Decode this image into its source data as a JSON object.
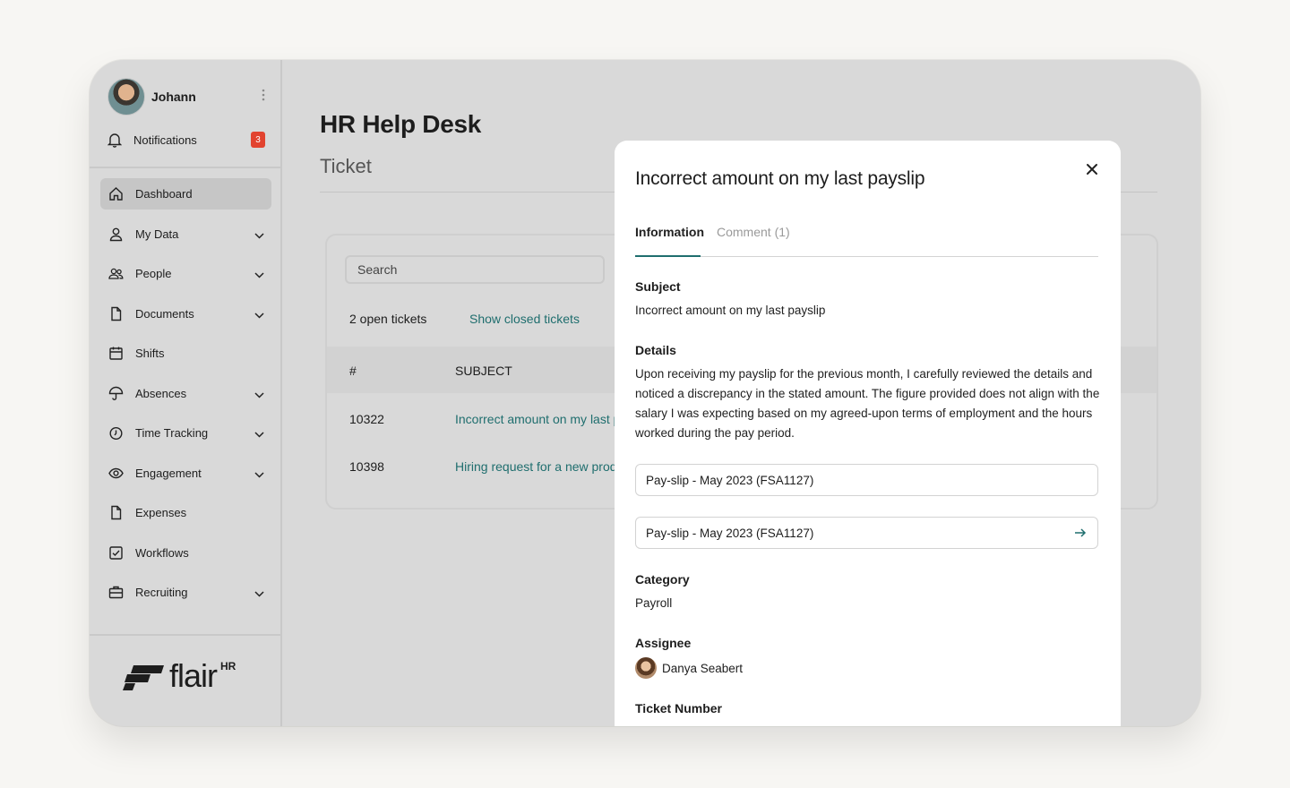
{
  "user": {
    "name": "Johann",
    "more_icon": "kebab-icon"
  },
  "notifications": {
    "label": "Notifications",
    "count": "3"
  },
  "nav": {
    "items": [
      {
        "label": "Dashboard",
        "icon": "home-icon",
        "active": true,
        "expandable": false
      },
      {
        "label": "My Data",
        "icon": "user-icon",
        "expandable": true
      },
      {
        "label": "People",
        "icon": "users-icon",
        "expandable": true
      },
      {
        "label": "Documents",
        "icon": "document-icon",
        "expandable": true
      },
      {
        "label": "Shifts",
        "icon": "calendar-icon",
        "expandable": false
      },
      {
        "label": "Absences",
        "icon": "umbrella-icon",
        "expandable": true
      },
      {
        "label": "Time Tracking",
        "icon": "clock-icon",
        "expandable": true
      },
      {
        "label": "Engagement",
        "icon": "eye-icon",
        "expandable": true
      },
      {
        "label": "Expenses",
        "icon": "document-icon",
        "expandable": false
      },
      {
        "label": "Workflows",
        "icon": "checkbox-icon",
        "expandable": false
      },
      {
        "label": "Recruiting",
        "icon": "briefcase-icon",
        "expandable": true
      }
    ]
  },
  "brand": {
    "word": "flair",
    "sup": "HR"
  },
  "page": {
    "title": "HR Help Desk",
    "subtitle": "Ticket"
  },
  "tickets": {
    "search_placeholder": "Search",
    "open_count_label": "2 open tickets",
    "show_closed_label": "Show closed tickets",
    "columns": [
      "#",
      "SUBJECT"
    ],
    "rows": [
      {
        "id": "10322",
        "subject": "Incorrect amount on my last payslip"
      },
      {
        "id": "10398",
        "subject": "Hiring request for a new product"
      }
    ]
  },
  "modal": {
    "title": "Incorrect amount on my last payslip",
    "tabs": [
      {
        "label": "Information",
        "active": true
      },
      {
        "label": "Comment (1)",
        "active": false
      }
    ],
    "subject_label": "Subject",
    "subject_value": "Incorrect amount on my last payslip",
    "details_label": "Details",
    "details_value": "Upon receiving my payslip for the previous month, I carefully reviewed the details and noticed a discrepancy in the stated amount. The figure provided does not align with the salary I was expecting based on my agreed-upon terms of employment and the hours worked during the pay period.",
    "attachments": [
      {
        "label": "Pay-slip - May 2023 (FSA1127)",
        "has_arrow": false
      },
      {
        "label": "Pay-slip - May 2023 (FSA1127)",
        "has_arrow": true
      }
    ],
    "category_label": "Category",
    "category_value": "Payroll",
    "assignee_label": "Assignee",
    "assignee_name": "Danya Seabert",
    "ticket_number_label": "Ticket Number"
  },
  "colors": {
    "accent": "#1f6e6e",
    "badge": "#e2432f",
    "backdrop": "#d9d9d9"
  }
}
